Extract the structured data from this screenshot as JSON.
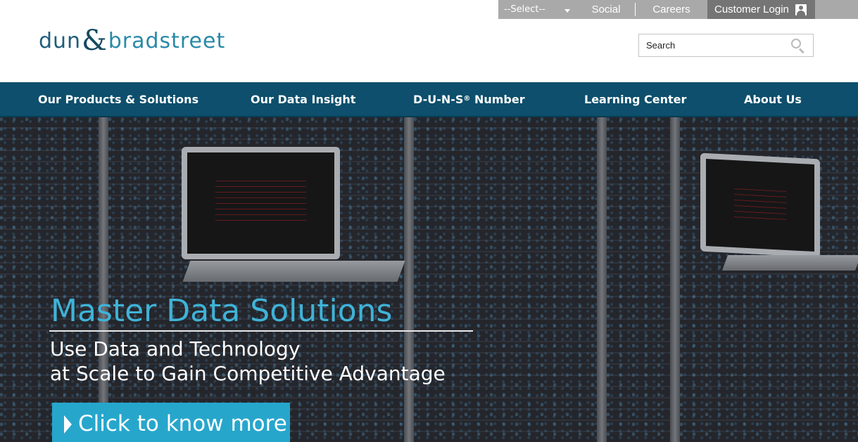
{
  "util_bar": {
    "select_value": "--Select--",
    "social_label": "Social",
    "careers_label": "Careers",
    "login_label": "Customer Login"
  },
  "logo": {
    "part1": "dun",
    "amp": "&",
    "part2": "bradstreet"
  },
  "search": {
    "placeholder": "Search"
  },
  "nav": {
    "items": [
      {
        "label": "Our Products & Solutions"
      },
      {
        "label": "Our Data Insight"
      },
      {
        "label": "D-U-N-S",
        "sup": "®",
        "suffix": " Number"
      },
      {
        "label": "Learning Center"
      },
      {
        "label": "About Us"
      }
    ]
  },
  "hero": {
    "title": "Master Data Solutions",
    "subtitle_line1": "Use Data and Technology",
    "subtitle_line2": "at Scale to Gain Competitive Advantage",
    "cta_label": "Click to know more"
  },
  "colors": {
    "nav_bg": "#0d4f6c",
    "util_bg": "#a9a9a9",
    "login_bg": "#757575",
    "hero_title": "#3fb3d8",
    "cta_bg": "#27a6cc"
  }
}
